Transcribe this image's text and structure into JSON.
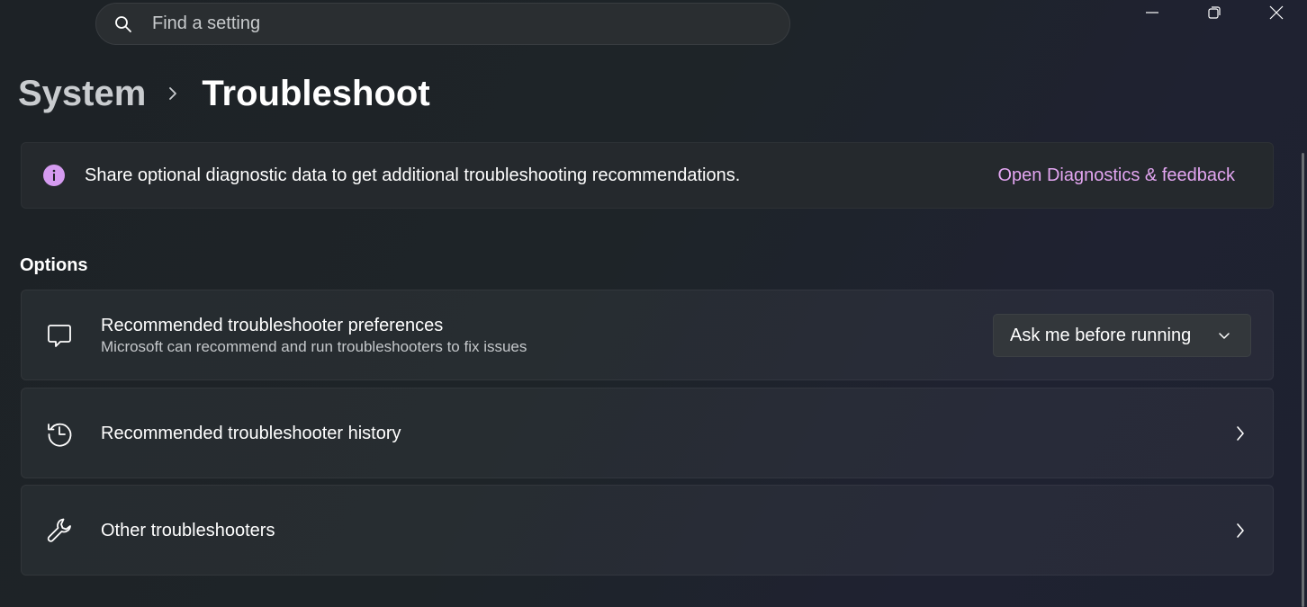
{
  "search": {
    "placeholder": "Find a setting"
  },
  "window_controls": {
    "minimize_icon": "minimize-icon",
    "restore_icon": "restore-icon",
    "close_icon": "close-icon"
  },
  "breadcrumb": {
    "parent": "System",
    "current": "Troubleshoot"
  },
  "infobar": {
    "icon": "info-icon",
    "text": "Share optional diagnostic data to get additional troubleshooting recommendations.",
    "link": "Open Diagnostics & feedback"
  },
  "options": {
    "heading": "Options",
    "items": [
      {
        "icon": "chat-bubble-icon",
        "title": "Recommended troubleshooter preferences",
        "subtitle": "Microsoft can recommend and run troubleshooters to fix issues",
        "dropdown_value": "Ask me before running"
      },
      {
        "icon": "history-icon",
        "title": "Recommended troubleshooter history"
      },
      {
        "icon": "wrench-icon",
        "title": "Other troubleshooters"
      }
    ]
  },
  "colors": {
    "accent": "#e3a6f1",
    "info_icon": "#d59bf0",
    "background": "#1c2024",
    "card": "#26292d"
  }
}
